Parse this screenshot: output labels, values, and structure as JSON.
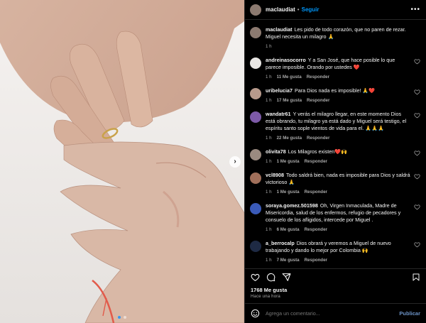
{
  "post": {
    "author": "maclaudiat",
    "separator": "•",
    "follow_label": "Seguir",
    "more_icon": "more-icon",
    "caption": {
      "user": "maclaudiat",
      "text": "Les pido de todo corazón, que no paren de rezar. Miguel necesita un milagro 🙏",
      "time": "1 h"
    }
  },
  "comments": [
    {
      "user": "andreinasocorro",
      "text": "Y a San José, que hace posible lo que parece imposible. Orando por ustedes ❤️",
      "time": "1 h",
      "likes": "11 Me gusta",
      "reply": "Responder"
    },
    {
      "user": "uribelucia7",
      "text": "Para Dios nada es imposible! 🙏❤️",
      "time": "1 h",
      "likes": "17 Me gusta",
      "reply": "Responder"
    },
    {
      "user": "wandatr61",
      "text": "Y verás el milagro llegar, en este momento Dios está obrando, tu milagro ya está dado y Miguel será testigo, el espíritu santo sople vientos de vida para el. 🙏🙏🙏",
      "time": "1 h",
      "likes": "22 Me gusta",
      "reply": "Responder"
    },
    {
      "user": "olivita78",
      "text": "Los Milagros existen❤️🙌",
      "time": "1 h",
      "likes": "1 Me gusta",
      "reply": "Responder"
    },
    {
      "user": "vcl8908",
      "text": "Todo saldrá bien, nada es imposible para Dios y saldrá victorioso 🙏",
      "time": "1 h",
      "likes": "1 Me gusta",
      "reply": "Responder"
    },
    {
      "user": "soraya.gomez.501598",
      "text": "Oh, Virgen Inmaculada, Madre de Misericordia, salud de los enfermos, refugio de pecadores y consuelo de los afligidos, intercede por Miguel .",
      "time": "1 h",
      "likes": "6 Me gusta",
      "reply": "Responder"
    },
    {
      "user": "a_berrocalp",
      "text": "Dios obrará y veremos a Miguel de nuevo trabajando y dando lo mejor por Colombia 🙌",
      "time": "1 h",
      "likes": "7 Me gusta",
      "reply": "Responder"
    }
  ],
  "stats": {
    "likes": "1768 Me gusta",
    "time": "Hace una hora"
  },
  "composer": {
    "placeholder": "Agrega un comentario...",
    "post_label": "Publicar"
  },
  "icons": [
    "like-icon",
    "comment-icon",
    "share-icon",
    "save-icon",
    "emoji-icon",
    "heart-icon",
    "next-icon"
  ],
  "colors": {
    "accent": "#0095f6",
    "background": "#000000",
    "muted": "#a8a8a8"
  }
}
